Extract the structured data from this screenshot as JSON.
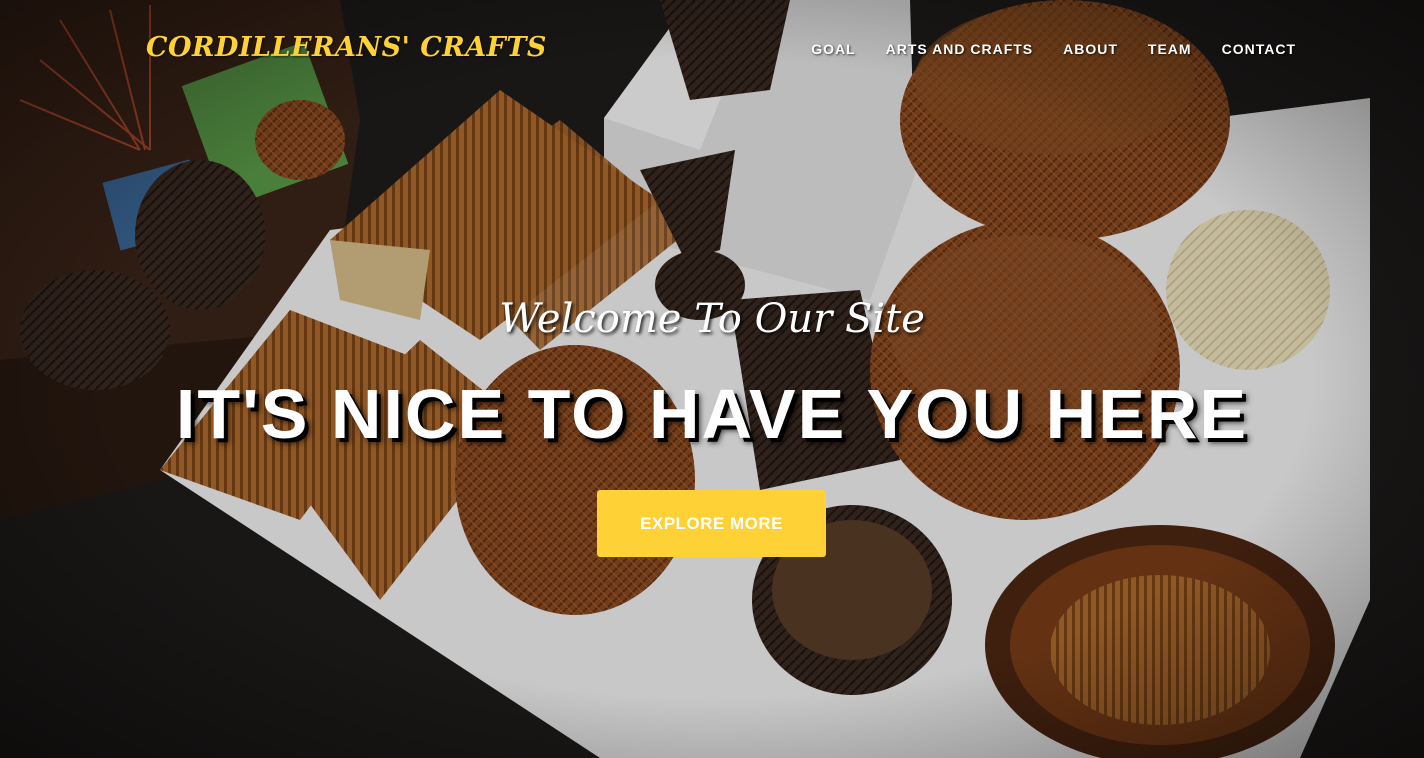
{
  "brand": {
    "name": "CORDILLERANS' CRAFTS",
    "color": "#fed136"
  },
  "nav": {
    "items": [
      {
        "label": "GOAL"
      },
      {
        "label": "ARTS AND CRAFTS"
      },
      {
        "label": "ABOUT"
      },
      {
        "label": "TEAM"
      },
      {
        "label": "CONTACT"
      }
    ]
  },
  "hero": {
    "lead_in": "Welcome To Our Site",
    "heading": "IT'S NICE TO HAVE YOU HERE",
    "button_label": "EXPLORE MORE",
    "accent_color": "#fed136"
  }
}
